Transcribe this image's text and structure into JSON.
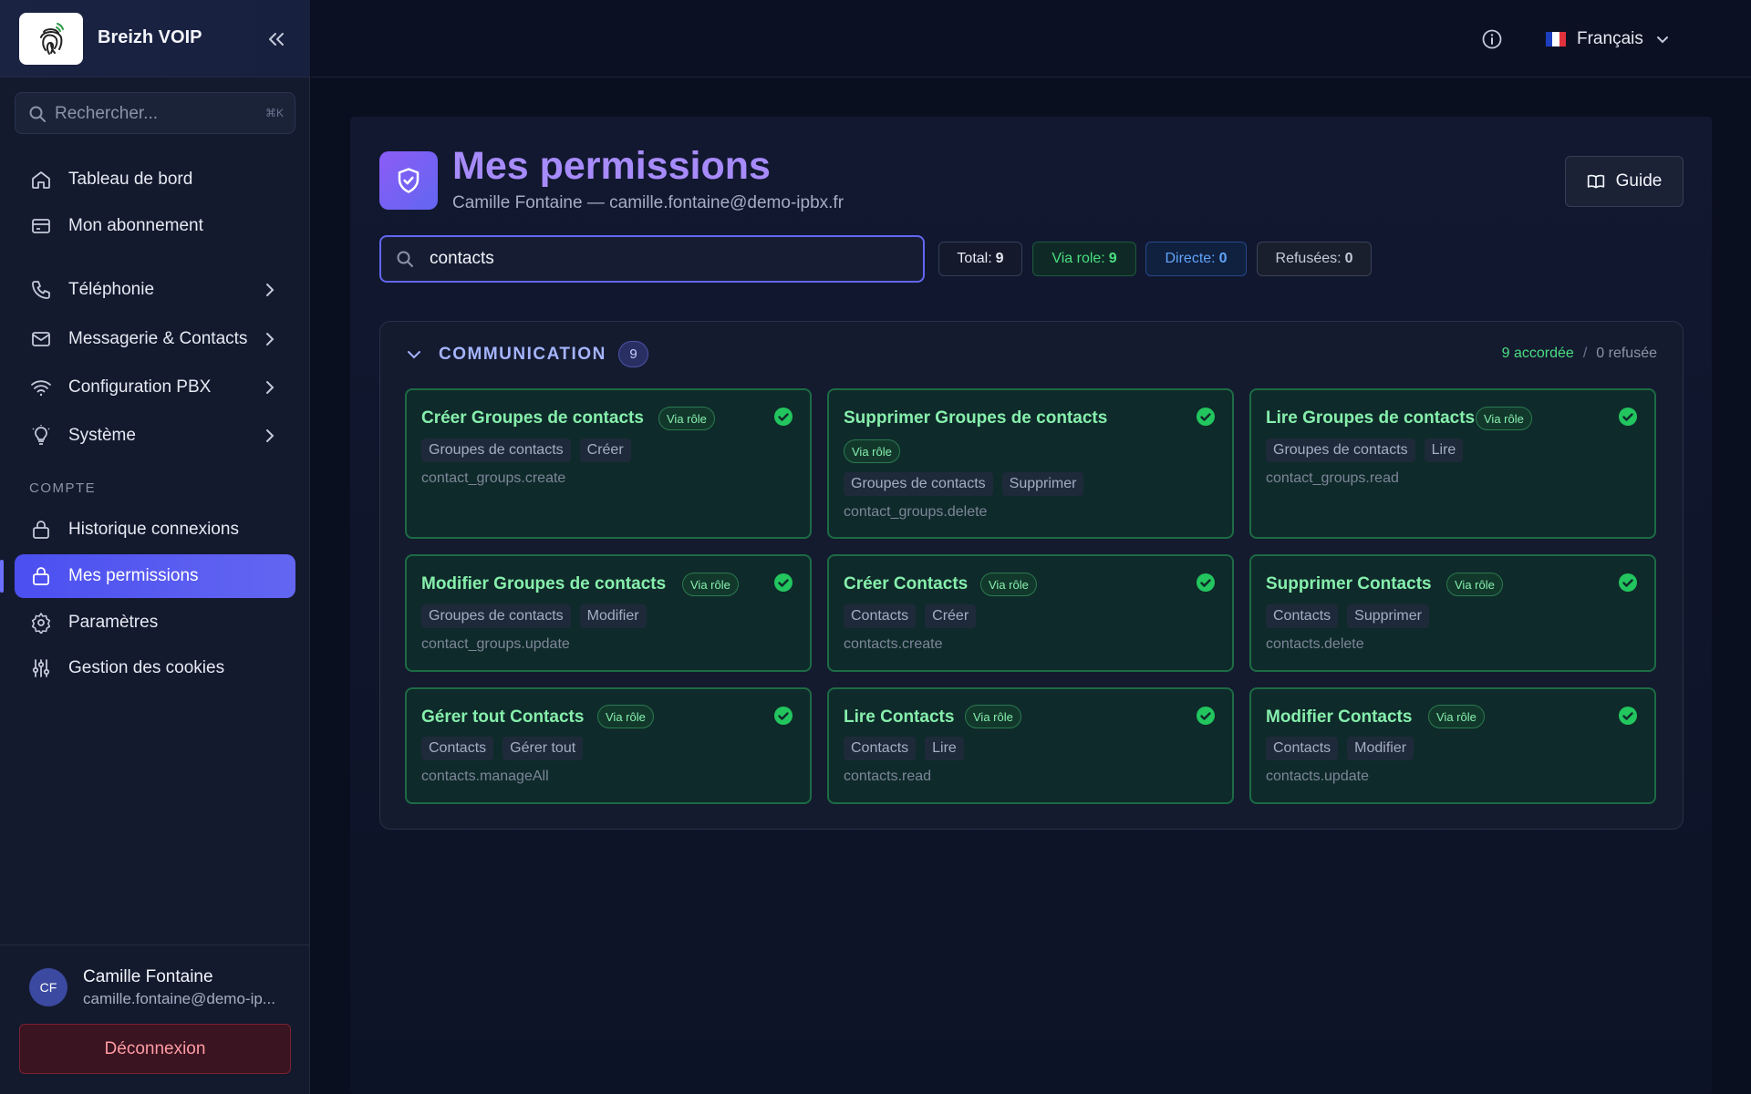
{
  "brand": {
    "name": "Breizh VOIP"
  },
  "sidebar": {
    "search_placeholder": "Rechercher...",
    "search_shortcut": "⌘K",
    "items": [
      {
        "label": "Tableau de bord",
        "icon": "home-icon"
      },
      {
        "label": "Mon abonnement",
        "icon": "credit-card-icon"
      },
      {
        "label": "Téléphonie",
        "icon": "phone-icon"
      },
      {
        "label": "Messagerie & Contacts",
        "icon": "mail-icon"
      },
      {
        "label": "Configuration PBX",
        "icon": "wifi-icon"
      },
      {
        "label": "Système",
        "icon": "lightbulb-icon"
      }
    ],
    "section_label": "COMPTE",
    "account_items": [
      {
        "label": "Historique connexions",
        "icon": "lock-icon"
      },
      {
        "label": "Mes permissions",
        "icon": "lock-icon",
        "active": true
      },
      {
        "label": "Paramètres",
        "icon": "gear-icon"
      },
      {
        "label": "Gestion des cookies",
        "icon": "sliders-icon"
      }
    ],
    "user": {
      "initials": "CF",
      "name": "Camille Fontaine",
      "email": "camille.fontaine@demo-ip..."
    },
    "logout_label": "Déconnexion"
  },
  "topbar": {
    "language": "Français"
  },
  "page": {
    "title": "Mes permissions",
    "subtitle": "Camille Fontaine — camille.fontaine@demo-ipbx.fr",
    "guide_label": "Guide",
    "filter_value": "contacts",
    "stats": {
      "total_label": "Total:",
      "total": "9",
      "role_label": "Via role:",
      "role": "9",
      "direct_label": "Directe:",
      "direct": "0",
      "refused_label": "Refusées:",
      "refused": "0"
    }
  },
  "group": {
    "title": "COMMUNICATION",
    "count": "9",
    "granted": "9 accordée",
    "sep": "/",
    "refused": "0 refusée",
    "cards": [
      {
        "title": "Créer Groupes de contacts",
        "badge": "Via rôle",
        "tags": [
          "Groupes de contacts",
          "Créer"
        ],
        "code": "contact_groups.create"
      },
      {
        "title": "Supprimer Groupes de contacts",
        "badge": "Via rôle",
        "tags": [
          "Groupes de contacts",
          "Supprimer"
        ],
        "code": "contact_groups.delete"
      },
      {
        "title": "Lire Groupes de contacts",
        "badge": "Via rôle",
        "tags": [
          "Groupes de contacts",
          "Lire"
        ],
        "code": "contact_groups.read"
      },
      {
        "title": "Modifier Groupes de contacts",
        "badge": "Via rôle",
        "tags": [
          "Groupes de contacts",
          "Modifier"
        ],
        "code": "contact_groups.update"
      },
      {
        "title": "Créer Contacts",
        "badge": "Via rôle",
        "tags": [
          "Contacts",
          "Créer"
        ],
        "code": "contacts.create"
      },
      {
        "title": "Supprimer Contacts",
        "badge": "Via rôle",
        "tags": [
          "Contacts",
          "Supprimer"
        ],
        "code": "contacts.delete"
      },
      {
        "title": "Gérer tout Contacts",
        "badge": "Via rôle",
        "tags": [
          "Contacts",
          "Gérer tout"
        ],
        "code": "contacts.manageAll"
      },
      {
        "title": "Lire Contacts",
        "badge": "Via rôle",
        "tags": [
          "Contacts",
          "Lire"
        ],
        "code": "contacts.read"
      },
      {
        "title": "Modifier Contacts",
        "badge": "Via rôle",
        "tags": [
          "Contacts",
          "Modifier"
        ],
        "code": "contacts.update"
      }
    ]
  },
  "colors": {
    "accent": "#6366f1",
    "granted": "#4ade80",
    "title": "#a78bfa"
  }
}
